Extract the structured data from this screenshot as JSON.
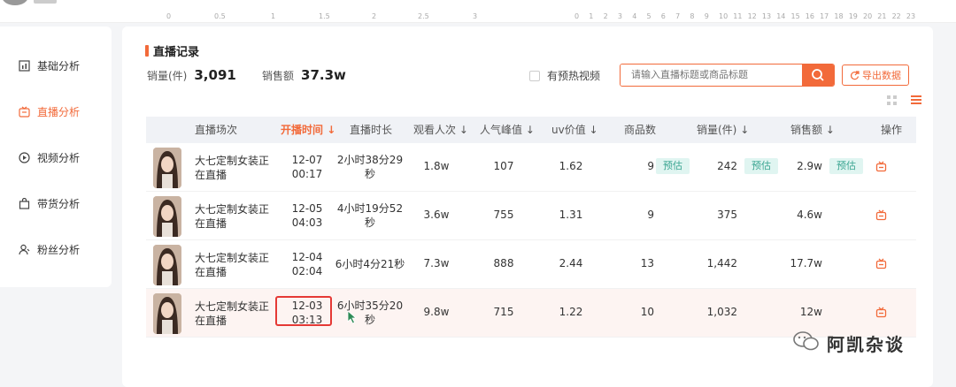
{
  "top_ticks_a": [
    "0",
    "0.5",
    "1",
    "1.5",
    "2",
    "2.5",
    "3"
  ],
  "top_ticks_b": [
    "0",
    "1",
    "2",
    "3",
    "4",
    "5",
    "6",
    "7",
    "8",
    "9",
    "10",
    "11",
    "12",
    "13",
    "14",
    "15",
    "16",
    "17",
    "18",
    "19",
    "20",
    "21",
    "22",
    "23"
  ],
  "sidebar": {
    "items": [
      {
        "label": "基础分析",
        "icon": "bar-chart-icon",
        "active": false
      },
      {
        "label": "直播分析",
        "icon": "live-tv-icon",
        "active": true
      },
      {
        "label": "视频分析",
        "icon": "play-circle-icon",
        "active": false
      },
      {
        "label": "带货分析",
        "icon": "shopping-bag-icon",
        "active": false
      },
      {
        "label": "粉丝分析",
        "icon": "user-icon",
        "active": false
      }
    ]
  },
  "main": {
    "title": "直播记录",
    "stats": [
      {
        "label": "销量(件)",
        "value": "3,091"
      },
      {
        "label": "销售额",
        "value": "37.3w"
      }
    ],
    "preheat_label": "有预热视频",
    "search_placeholder": "请输入直播标题或商品标题",
    "export_label": "导出数据",
    "accent_color": "#f26a3a"
  },
  "table": {
    "columns": [
      "直播场次",
      "开播时间",
      "直播时长",
      "观看人次",
      "人气峰值",
      "uv价值",
      "商品数",
      "销量(件)",
      "销售额",
      "操作"
    ],
    "sort_arrow": "↓",
    "estimate_label": "预估",
    "rows": [
      {
        "title_l1": "大七定制女装正",
        "title_l2": "在直播",
        "date": "12-07",
        "time": "00:17",
        "dur_l1": "2小时38分29",
        "dur_l2": "秒",
        "views": "1.8w",
        "peak": "107",
        "uv": "1.62",
        "goods": "9",
        "sales": "242",
        "revenue": "2.9w",
        "estimate": true
      },
      {
        "title_l1": "大七定制女装正",
        "title_l2": "在直播",
        "date": "12-05",
        "time": "04:03",
        "dur_l1": "4小时19分52",
        "dur_l2": "秒",
        "views": "3.6w",
        "peak": "755",
        "uv": "1.31",
        "goods": "9",
        "sales": "375",
        "revenue": "4.6w",
        "estimate": false
      },
      {
        "title_l1": "大七定制女装正",
        "title_l2": "在直播",
        "date": "12-04",
        "time": "02:04",
        "dur_l1": "6小时4分21秒",
        "dur_l2": "",
        "views": "7.3w",
        "peak": "888",
        "uv": "2.44",
        "goods": "13",
        "sales": "1,442",
        "revenue": "17.7w",
        "estimate": false
      },
      {
        "title_l1": "大七定制女装正",
        "title_l2": "在直播",
        "date": "12-03",
        "time": "03:13",
        "dur_l1": "6小时35分20",
        "dur_l2": "秒",
        "views": "9.8w",
        "peak": "715",
        "uv": "1.22",
        "goods": "10",
        "sales": "1,032",
        "revenue": "12w",
        "estimate": false
      }
    ]
  },
  "watermark": "阿凯杂谈"
}
